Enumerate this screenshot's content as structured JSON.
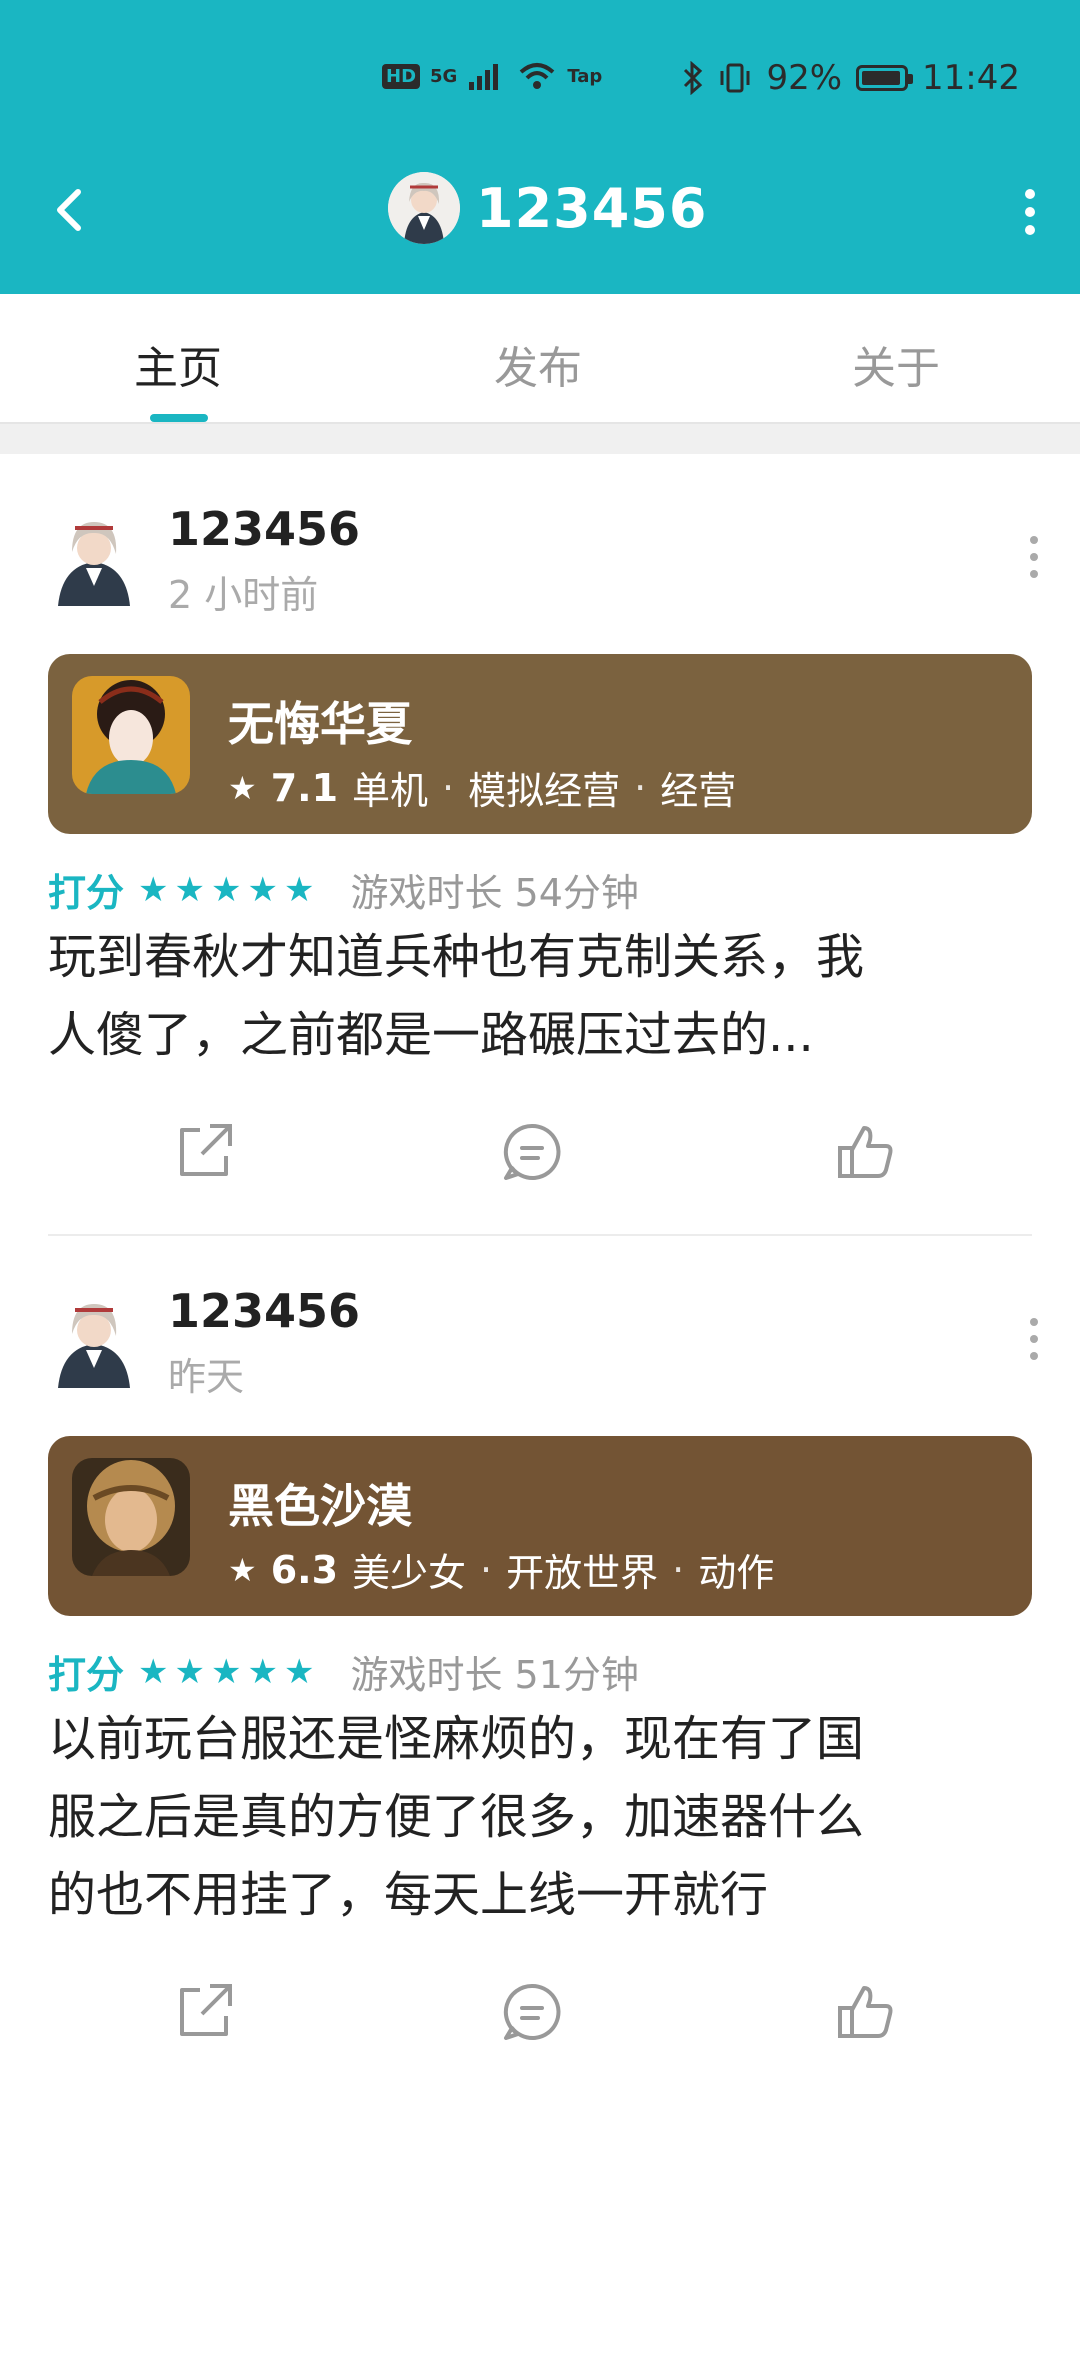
{
  "status_bar": {
    "hd": "HD",
    "net": "5G",
    "tap": "Tap",
    "battery": "92%",
    "time": "11:42"
  },
  "app_bar": {
    "title": "123456"
  },
  "tabs": [
    {
      "label": "主页",
      "active": true
    },
    {
      "label": "发布",
      "active": false
    },
    {
      "label": "关于",
      "active": false
    }
  ],
  "posts": [
    {
      "username": "123456",
      "time": "2 小时前",
      "game": {
        "name": "无悔华夏",
        "rating": "7.1",
        "tags": [
          "单机",
          "模拟经营",
          "经营"
        ],
        "card_color": "#7b623f"
      },
      "score_label": "打分",
      "stars": 5,
      "playtime": "游戏时长 54分钟",
      "review_lines": [
        "玩到春秋才知道兵种也有克制关系，我",
        "人傻了，之前都是一路碾压过去的..."
      ]
    },
    {
      "username": "123456",
      "time": "昨天",
      "game": {
        "name": "黑色沙漠",
        "rating": "6.3",
        "tags": [
          "美少女",
          "开放世界",
          "动作"
        ],
        "card_color": "#735434"
      },
      "score_label": "打分",
      "stars": 5,
      "playtime": "游戏时长 51分钟",
      "review_lines": [
        "以前玩台服还是怪麻烦的，现在有了国",
        "服之后是真的方便了很多，加速器什么",
        "的也不用挂了，每天上线一开就行"
      ]
    }
  ],
  "colors": {
    "accent": "#1ab6c2",
    "header_bg": "#1ab6c2",
    "text_primary": "#222222",
    "text_secondary": "#999999"
  },
  "icons": {
    "share": "share-icon",
    "comment": "comment-icon",
    "like": "thumbs-up-icon",
    "back": "back-arrow-icon",
    "more": "more-vertical-icon"
  }
}
